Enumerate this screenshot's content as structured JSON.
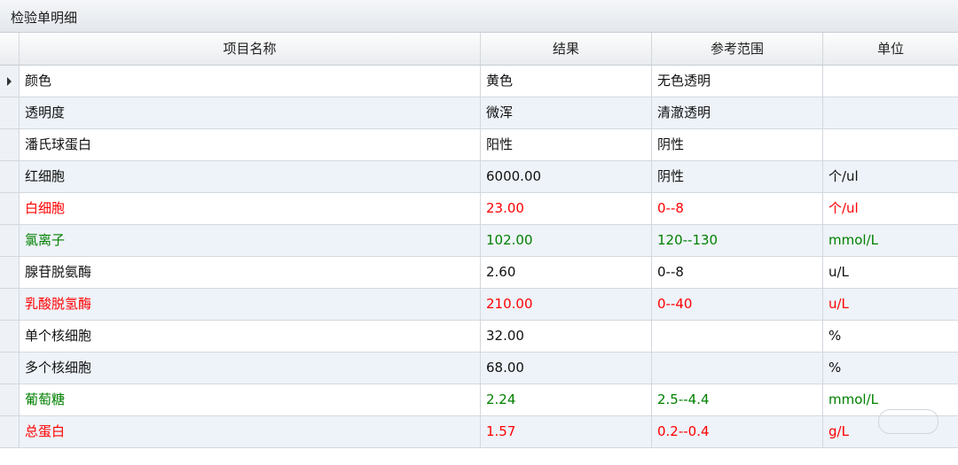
{
  "panel": {
    "title": "检验单明细"
  },
  "columns": {
    "name": "项目名称",
    "result": "结果",
    "reference": "参考范围",
    "unit": "单位"
  },
  "colors": {
    "normal": "#111111",
    "high": "#ff0000",
    "low": "#008000"
  },
  "rows": [
    {
      "name": "颜色",
      "result": "黄色",
      "reference": "无色透明",
      "unit": "",
      "status": "normal",
      "selected": true
    },
    {
      "name": "透明度",
      "result": "微浑",
      "reference": "清澈透明",
      "unit": "",
      "status": "normal"
    },
    {
      "name": "潘氏球蛋白",
      "result": "阳性",
      "reference": "阴性",
      "unit": "",
      "status": "normal"
    },
    {
      "name": "红细胞",
      "result": "6000.00",
      "reference": "阴性",
      "unit": "个/ul",
      "status": "normal"
    },
    {
      "name": "白细胞",
      "result": "23.00",
      "reference": "0--8",
      "unit": "个/ul",
      "status": "high"
    },
    {
      "name": "氯离子",
      "result": "102.00",
      "reference": "120--130",
      "unit": "mmol/L",
      "status": "low"
    },
    {
      "name": "腺苷脱氨酶",
      "result": "2.60",
      "reference": "0--8",
      "unit": "u/L",
      "status": "normal"
    },
    {
      "name": "乳酸脱氢酶",
      "result": "210.00",
      "reference": "0--40",
      "unit": "u/L",
      "status": "high"
    },
    {
      "name": "单个核细胞",
      "result": "32.00",
      "reference": "",
      "unit": "%",
      "status": "normal"
    },
    {
      "name": "多个核细胞",
      "result": "68.00",
      "reference": "",
      "unit": "%",
      "status": "normal"
    },
    {
      "name": "葡萄糖",
      "result": "2.24",
      "reference": "2.5--4.4",
      "unit": "mmol/L",
      "status": "low"
    },
    {
      "name": "总蛋白",
      "result": "1.57",
      "reference": "0.2--0.4",
      "unit": "g/L",
      "status": "high"
    }
  ]
}
